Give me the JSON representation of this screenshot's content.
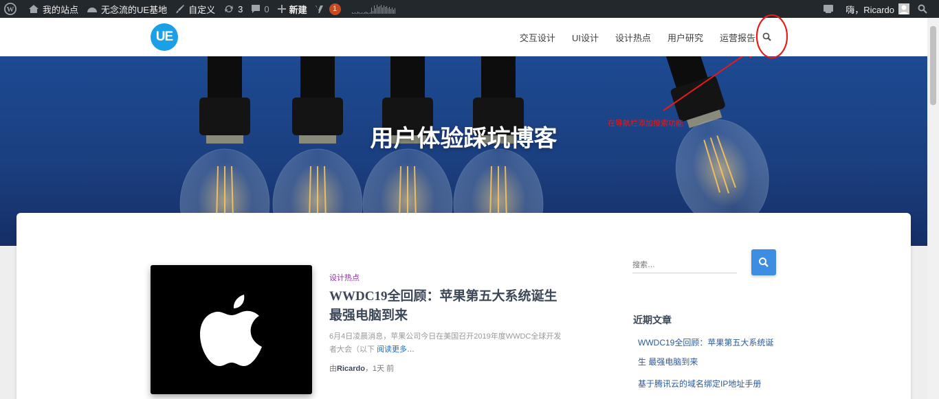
{
  "admin_bar": {
    "site_label": "我的站点",
    "ue_label": "无念流的UE基地",
    "customize_label": "自定义",
    "updates_count": "3",
    "comments_count": "0",
    "new_label": "新建",
    "yoast_badge": "1",
    "greeting": "嗨，Ricardo"
  },
  "header": {
    "logo_text": "UE",
    "menu": [
      "交互设计",
      "UI设计",
      "设计热点",
      "用户研究",
      "运营报告"
    ]
  },
  "hero": {
    "title": "用户体验踩坑博客",
    "annotation": "在导航栏添加搜索功能"
  },
  "post": {
    "category": "设计热点",
    "title": "WWDC19全回顾：苹果第五大系统诞生 最强电脑到来",
    "excerpt": "6月4日凌晨消息，苹果公司今日在美国召开2019年度WWDC全球开发者大会（以下",
    "read_more": "阅读更多…",
    "meta_prefix": "由",
    "author": "Ricardo",
    "meta_suffix": "，1天 前"
  },
  "sidebar": {
    "search_placeholder": "搜索…",
    "recent_title": "近期文章",
    "recent_1_line1": "WWDC19全回顾：苹果第五大系统诞",
    "recent_1_line2": "生 最强电脑到来",
    "recent_2": "基于腾讯云的域名绑定IP地址手册"
  },
  "colors": {
    "admin_bar": "#23282d",
    "accent": "#3d8ee3",
    "category": "#9c27b0",
    "annotation": "#e81a1a"
  }
}
